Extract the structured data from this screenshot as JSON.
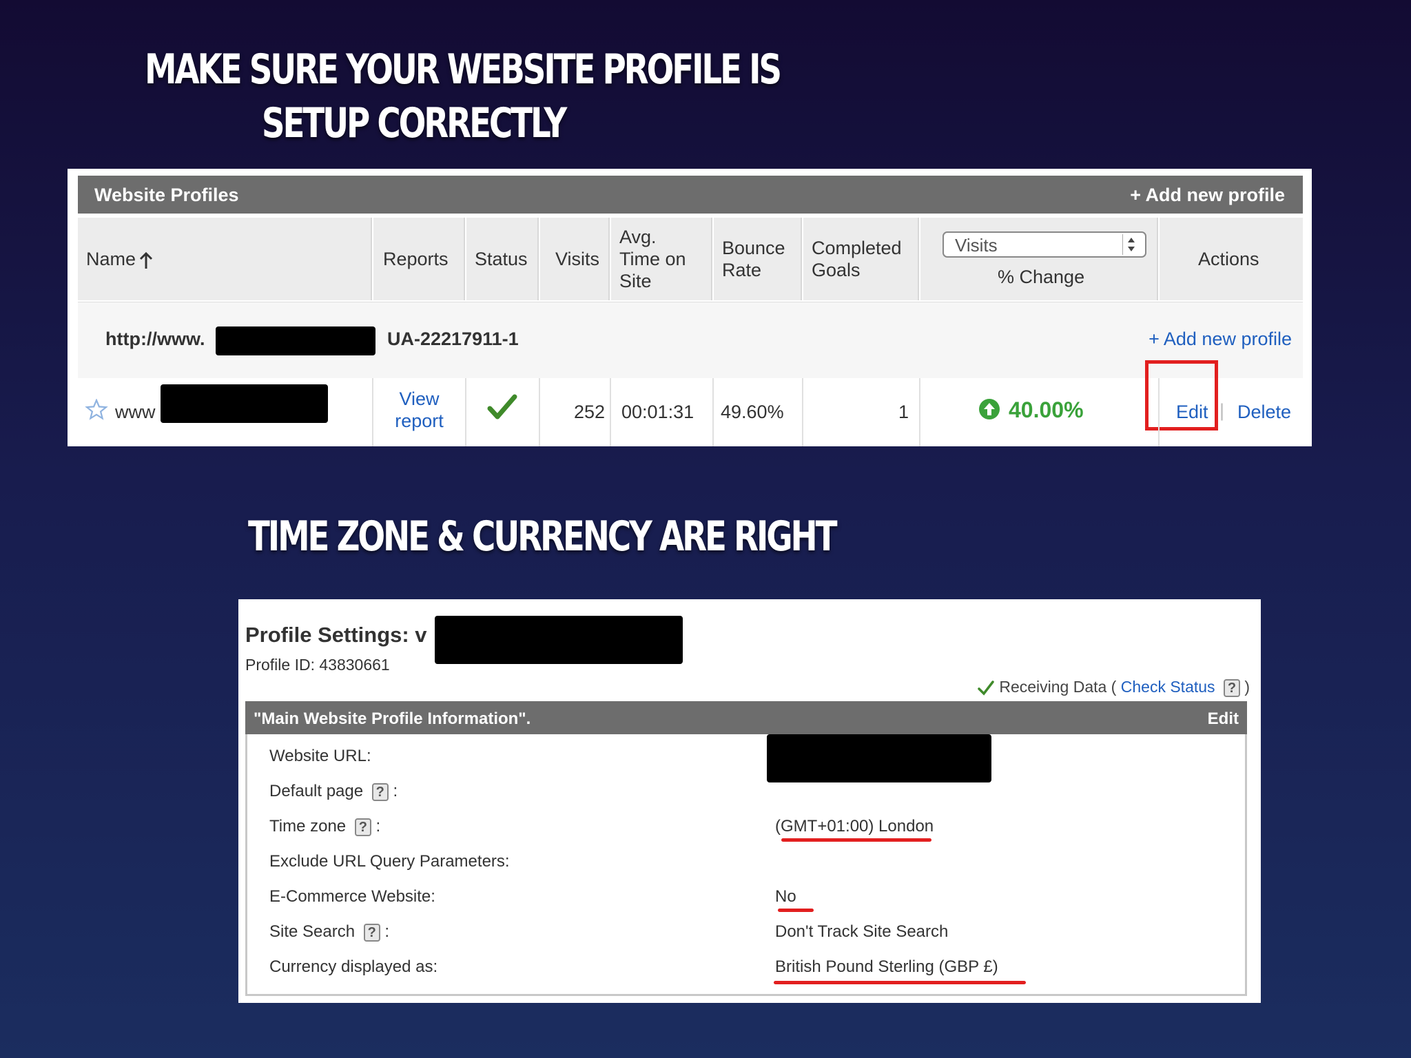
{
  "slide": {
    "heading1_line1": "Make sure your website profile is",
    "heading1_line2": "setup correctly",
    "heading2": "Time zone &  currency are right"
  },
  "profiles_panel": {
    "title": "Website Profiles",
    "add_profile_top": "+ Add new profile",
    "columns": {
      "name": "Name",
      "reports": "Reports",
      "status": "Status",
      "visits": "Visits",
      "avg_time": [
        "Avg.",
        "Time on",
        "Site"
      ],
      "bounce": [
        "Bounce",
        "Rate"
      ],
      "goals": [
        "Completed",
        "Goals"
      ],
      "metric_select": "Visits",
      "pct_change": "% Change",
      "actions": "Actions"
    },
    "account_row": {
      "url_prefix": "http://www.",
      "ua_id": "UA-22217911-1",
      "add_profile": "+ Add new profile"
    },
    "profile_row": {
      "name_prefix": "www",
      "view_report_line1": "View",
      "view_report_line2": "report",
      "visits": "252",
      "avg_time": "00:01:31",
      "bounce_rate": "49.60%",
      "goals": "1",
      "change": "40.00%",
      "edit": "Edit",
      "separator": "|",
      "delete": "Delete"
    }
  },
  "settings_panel": {
    "title": "Profile Settings: v",
    "profile_id": "Profile ID: 43830661",
    "receiving_data": "Receiving Data (",
    "check_status": "Check Status",
    "close_paren": ")",
    "section_title": "\"Main Website Profile Information\".",
    "edit": "Edit",
    "fields": [
      {
        "label": "Website URL:",
        "value": ""
      },
      {
        "label": "Default page",
        "value": ""
      },
      {
        "label": "Time zone",
        "value": "(GMT+01:00) London"
      },
      {
        "label": "Exclude URL Query Parameters:",
        "value": ""
      },
      {
        "label": "E-Commerce Website:",
        "value": "No"
      },
      {
        "label": "Site Search",
        "value": "Don't Track Site Search"
      },
      {
        "label": "Currency displayed as:",
        "value": "British Pound Sterling (GBP £)"
      }
    ]
  },
  "colors": {
    "header_bar": "#6d6d6d",
    "link_blue": "#1f5fbf",
    "positive_green": "#3aa23a",
    "highlight_red": "#e21f1f"
  }
}
